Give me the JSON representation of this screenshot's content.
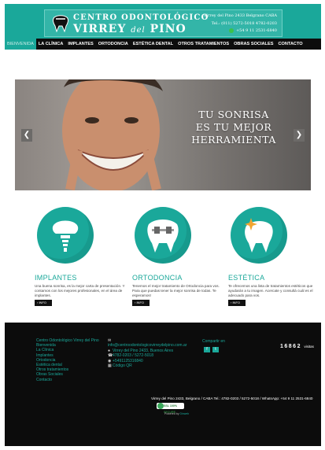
{
  "header": {
    "logo_line1": "CENTRO ODONTOLÓGICO",
    "logo_line2_a": "VIRREY",
    "logo_line2_b": "del",
    "logo_line2_c": "PINO",
    "address": "Virrey del Pino 2433 Belgrano CABA",
    "phones": "Tel.: (011) 5272-5018 4782-0203",
    "whatsapp": "+54 9 11 2531-6840"
  },
  "nav": {
    "items": [
      "BIENVENIDA",
      "LA CLÍNICA",
      "IMPLANTES",
      "ORTODONCIA",
      "ESTÉTICA DENTAL",
      "OTROS TRATAMIENTOS",
      "OBRAS SOCIALES",
      "CONTACTO"
    ],
    "active": "BIENVENIDA"
  },
  "slider": {
    "line1": "TU SONRISA",
    "line2": "ES TU MEJOR",
    "line3": "HERRAMIENTA",
    "prev": "❮",
    "next": "❯"
  },
  "features": [
    {
      "title": "IMPLANTES",
      "text": "Una buena sonrisa, es la mejor carta de presentación. Y contamos con los mejores profesionales, en el área de implantes.",
      "more": "› INFO",
      "icon": "implant-tooth-icon"
    },
    {
      "title": "ORTODONCIA",
      "text": "Tenemos el mejor tratamiento de Ortodoncia para vos. Para que puedas tener la mejor sonrisa de todas. Te esperamos!",
      "more": "› INFO",
      "icon": "braces-tooth-icon"
    },
    {
      "title": "ESTÉTICA",
      "text": "Te ofrecemos una lista de tratamientos estéticos que ayudarán a tu imagen. Acercate y consultá cuál es el adecuado para vos.",
      "more": "› INFO",
      "icon": "sparkle-tooth-icon"
    }
  ],
  "footer": {
    "links": [
      "Centro Odontológico Virrey del Pino",
      "Bienvenida",
      "La Clínica",
      "Implantes",
      "Ortodoncia",
      "Estética dental",
      "Otros tratamientos",
      "Obras Sociales",
      "Contacto"
    ],
    "email": "info@centroodontologicovirreydelpino.com.ar",
    "address": "Virrey del Pino 2433, Buenos Aires",
    "phone": "4782-0203 / 5272-5018",
    "whatsapp": "+5491125316840",
    "qr": "Código QR",
    "share_title": "Compartir en",
    "share_fb": "f",
    "share_tw": "t",
    "counter": "16862",
    "counter_label": "visitas",
    "bottom_address": "Virrey del Pino 2433, Belgrano / CABA Tel.: 4782-0203 / 5272-5018 / WhatsApp: +54 9 11 2531-6840",
    "ssl": "SSL 100% SECURE",
    "powered_prefix": "Powered by",
    "powered_brand": "Dinweb"
  },
  "colors": {
    "brand": "#1aa89a",
    "nav_bg": "#0d0d0d",
    "footer_bg": "#0c0c0c"
  }
}
